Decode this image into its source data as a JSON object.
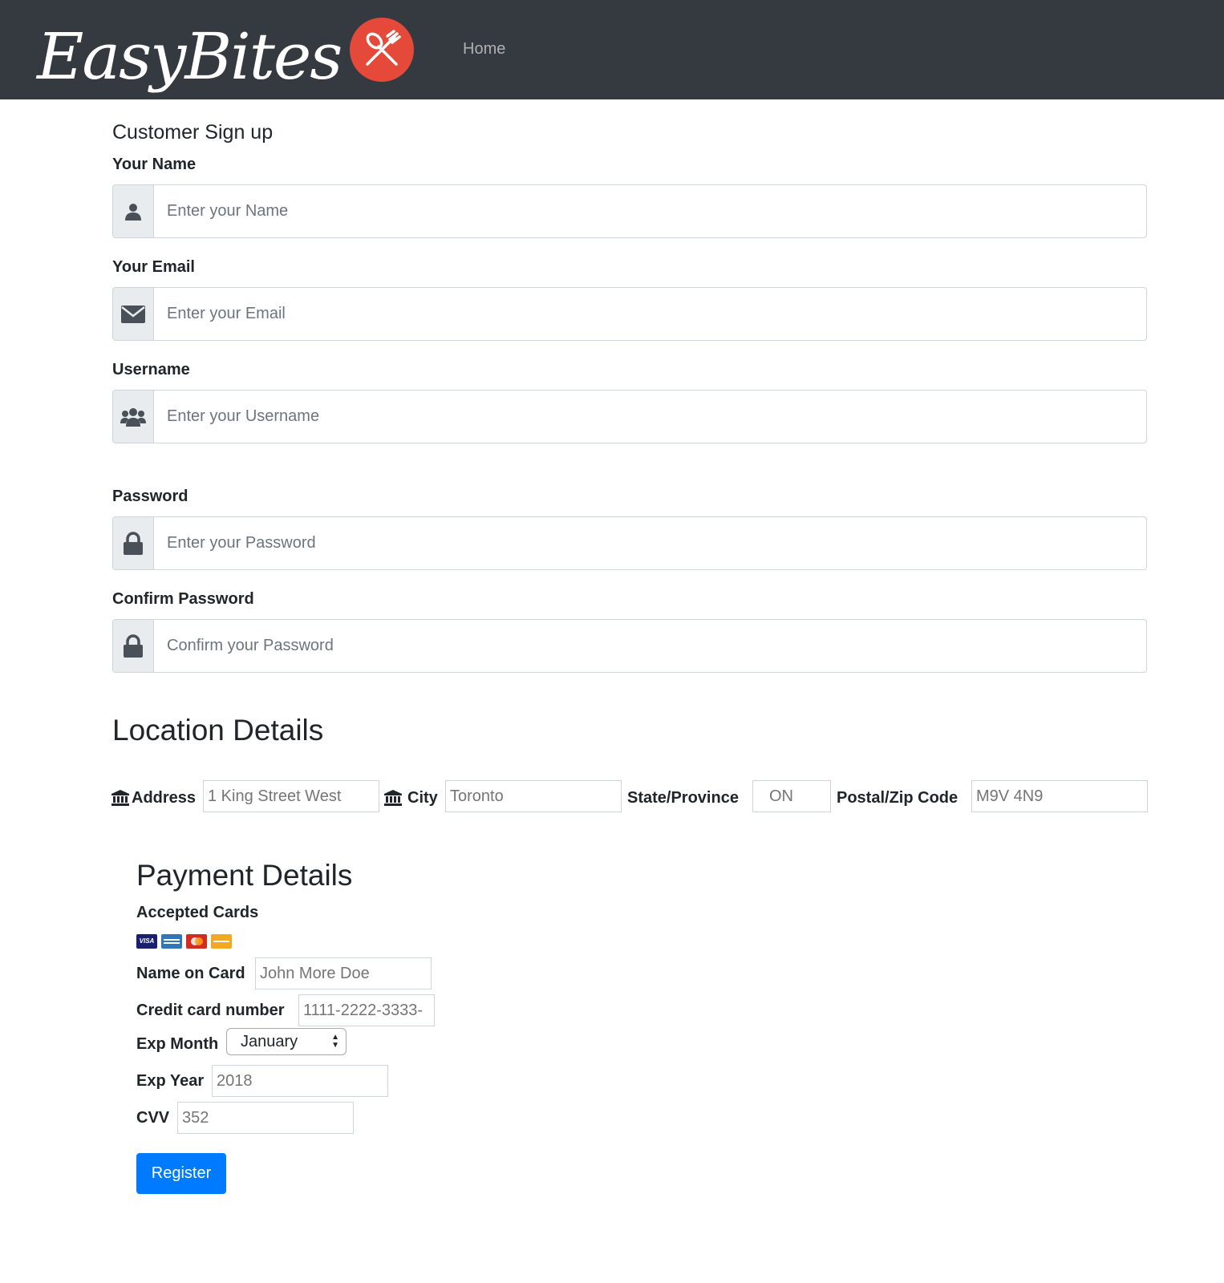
{
  "nav": {
    "brand": "EasyBites",
    "logo_icon": "fork-spoon-icon",
    "home_link": "Home"
  },
  "form": {
    "heading": "Customer Sign up",
    "name": {
      "label": "Your Name",
      "placeholder": "Enter your Name",
      "icon": "user-icon"
    },
    "email": {
      "label": "Your Email",
      "placeholder": "Enter your Email",
      "icon": "envelope-icon"
    },
    "username": {
      "label": "Username",
      "placeholder": "Enter your Username",
      "icon": "users-icon"
    },
    "password": {
      "label": "Password",
      "placeholder": "Enter your Password",
      "icon": "lock-icon"
    },
    "confirm": {
      "label": "Confirm Password",
      "placeholder": "Confirm your Password",
      "icon": "lock-icon"
    }
  },
  "location": {
    "title": "Location Details",
    "address": {
      "label": "Address",
      "placeholder": "1 King Street West",
      "icon": "bank-icon"
    },
    "city": {
      "label": "City",
      "placeholder": "Toronto",
      "icon": "bank-icon"
    },
    "state": {
      "label": "State/Province",
      "placeholder": "ON"
    },
    "postal": {
      "label": "Postal/Zip Code",
      "placeholder": "M9V 4N9"
    }
  },
  "payment": {
    "title": "Payment Details",
    "accepted_cards_label": "Accepted Cards",
    "card_icons": [
      "visa-icon",
      "amex-icon",
      "mastercard-icon",
      "discover-icon"
    ],
    "visa_text": "VISA",
    "name_on_card": {
      "label": "Name on Card",
      "placeholder": "John More Doe"
    },
    "card_number": {
      "label": "Credit card number",
      "placeholder": "1111-2222-3333-"
    },
    "exp_month": {
      "label": "Exp Month",
      "value": "January"
    },
    "exp_year": {
      "label": "Exp Year",
      "placeholder": "2018"
    },
    "cvv": {
      "label": "CVV",
      "placeholder": "352"
    },
    "register_button": "Register"
  },
  "colors": {
    "navbar": "#343a40",
    "logo_circle": "#e4493a",
    "primary_button": "#007bff"
  }
}
